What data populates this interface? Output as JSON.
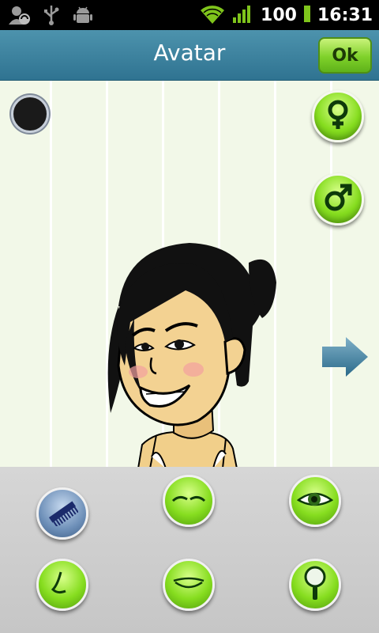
{
  "status_bar": {
    "left_icons": [
      "account-sync-icon",
      "usb-icon",
      "android-debug-icon"
    ],
    "battery_level": "100",
    "time": "16:31"
  },
  "header": {
    "title": "Avatar",
    "ok_label": "Ok"
  },
  "editor": {
    "selected_color": "#1a1a1a",
    "gender_buttons": [
      "female-icon",
      "male-icon"
    ],
    "next_icon": "arrow-right-icon"
  },
  "tools": [
    {
      "icon": "comb-icon",
      "selected": true
    },
    {
      "icon": "eyebrows-icon",
      "selected": false
    },
    {
      "icon": "eye-icon",
      "selected": false
    },
    {
      "icon": "nose-icon",
      "selected": false
    },
    {
      "icon": "mouth-icon",
      "selected": false
    },
    {
      "icon": "mirror-icon",
      "selected": false
    }
  ],
  "colors": {
    "title_bar": "#3a84a1",
    "canvas_bg": "#f2f8e8",
    "accent_green": "#86dd1f",
    "panel_bg": "#cfcfcf"
  }
}
